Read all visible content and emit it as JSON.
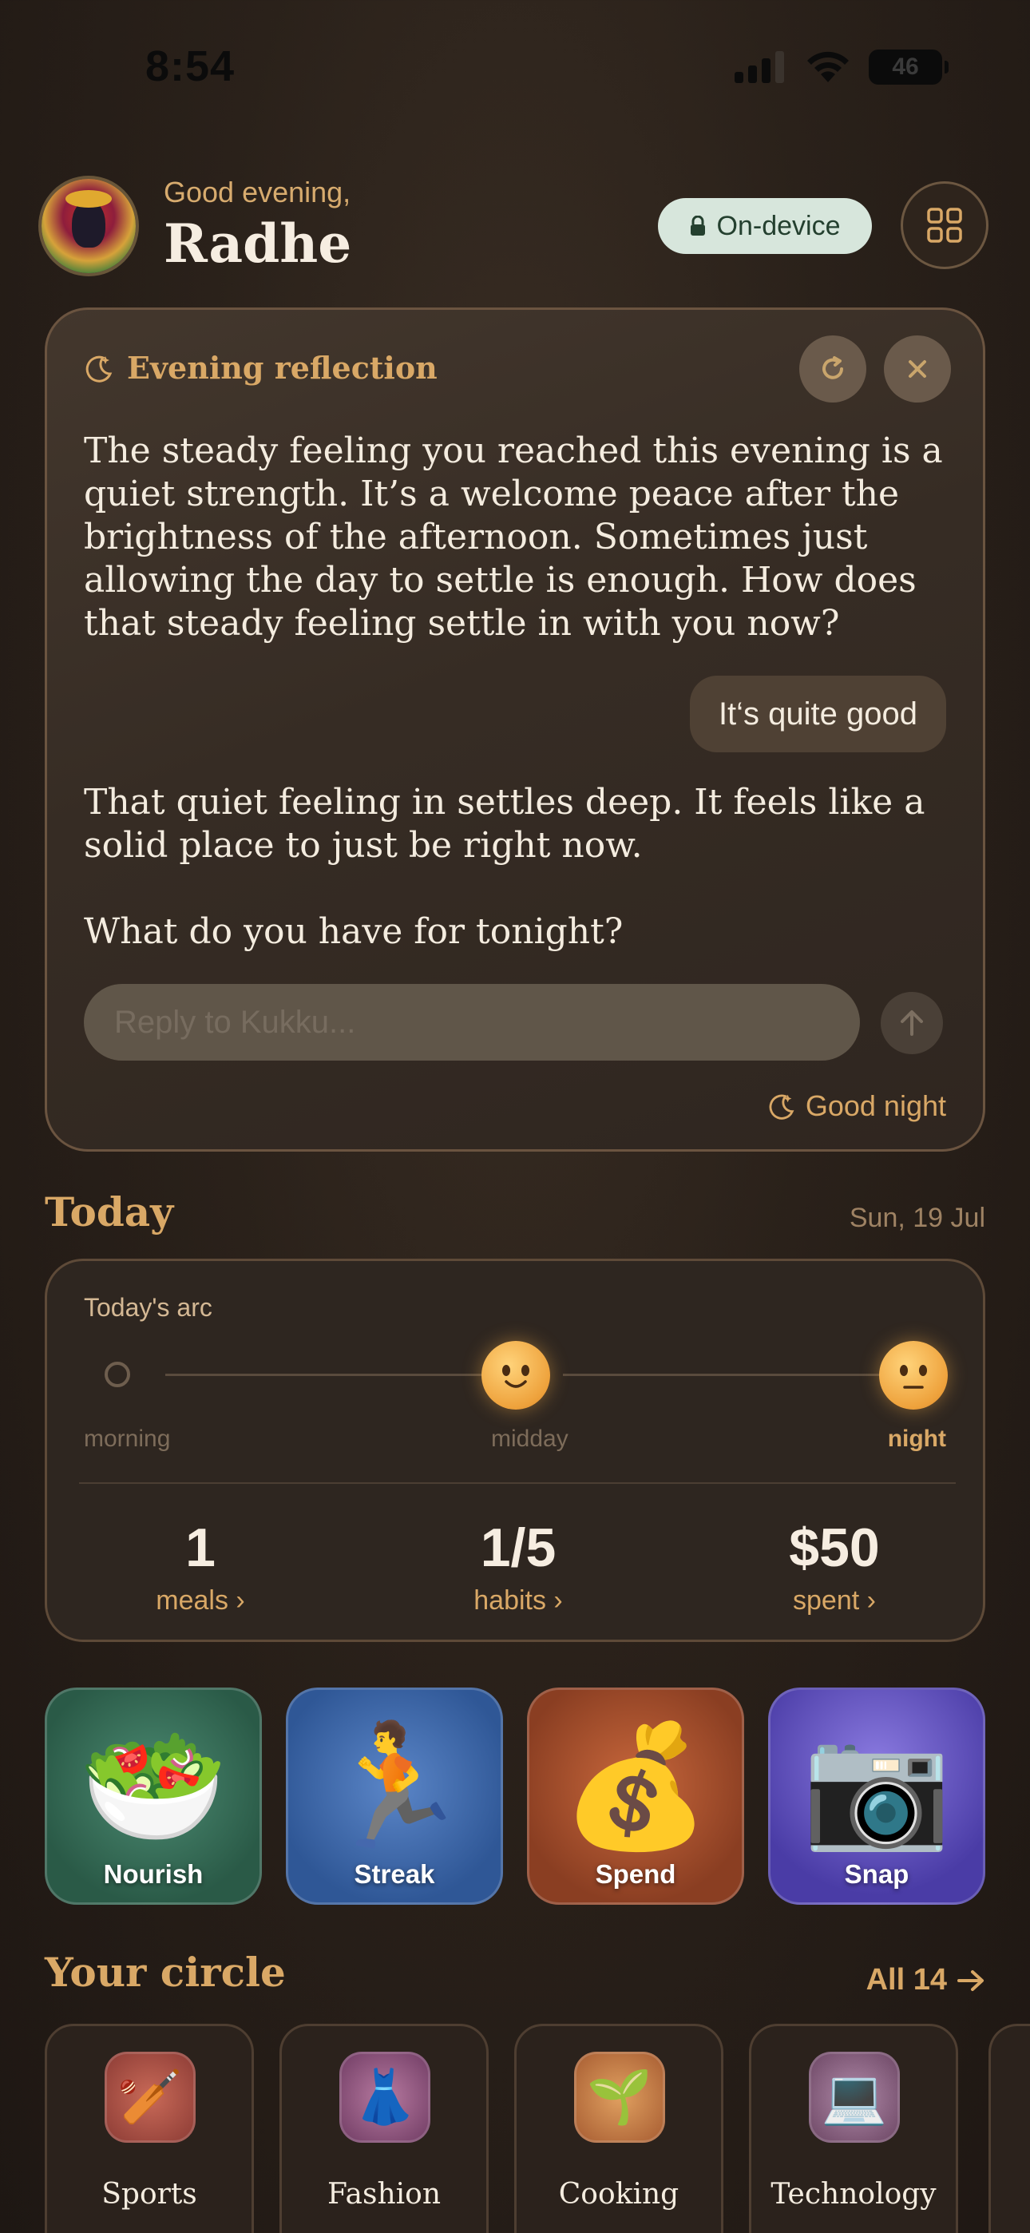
{
  "status_bar": {
    "time": "8:54",
    "battery": "46"
  },
  "header": {
    "greeting": "Good evening,",
    "name": "Radhe",
    "badge": "On-device"
  },
  "reflection": {
    "title": "Evening reflection",
    "message_1": "The steady feeling you reached this evening is a quiet strength. It’s a welcome peace after the brightness of the afternoon. Sometimes just allowing the day to settle is enough. How does that steady feeling settle in with you now?",
    "user_reply": "It‘s quite good",
    "message_2": "That quiet feeling in settles deep. It feels like a solid place to just be right now.",
    "message_3": "What do you have for tonight?",
    "input_placeholder": "Reply to Kukku...",
    "input_value": "",
    "goodnight_label": "Good night"
  },
  "today": {
    "title": "Today",
    "date": "Sun, 19 Jul",
    "arc": {
      "label": "Today's arc",
      "morning": "morning",
      "midday": "midday",
      "night": "night"
    },
    "stats": [
      {
        "value": "1",
        "label": "meals ›"
      },
      {
        "value": "1/5",
        "label": "habits ›"
      },
      {
        "value": "$50",
        "label": "spent ›"
      }
    ]
  },
  "tiles": [
    {
      "label": "Nourish",
      "icon": "salad-icon",
      "glyph": "🥗",
      "color": "#2f6a55"
    },
    {
      "label": "Streak",
      "icon": "runner-icon",
      "glyph": "🏃",
      "color": "#3a63a8"
    },
    {
      "label": "Spend",
      "icon": "money-bag-icon",
      "glyph": "💰",
      "color": "#a34e2c"
    },
    {
      "label": "Snap",
      "icon": "camera-icon",
      "glyph": "📷",
      "color": "#5a4bb4"
    }
  ],
  "circle": {
    "title": "Your circle",
    "all_label": "All 14",
    "items": [
      {
        "label": "Sports",
        "icon": "cricket-icon",
        "glyph": "🏏"
      },
      {
        "label": "Fashion",
        "icon": "dress-icon",
        "glyph": "👗"
      },
      {
        "label": "Cooking",
        "icon": "seedling-icon",
        "glyph": "🌱"
      },
      {
        "label": "Technology",
        "icon": "laptop-icon",
        "glyph": "💻"
      }
    ]
  }
}
